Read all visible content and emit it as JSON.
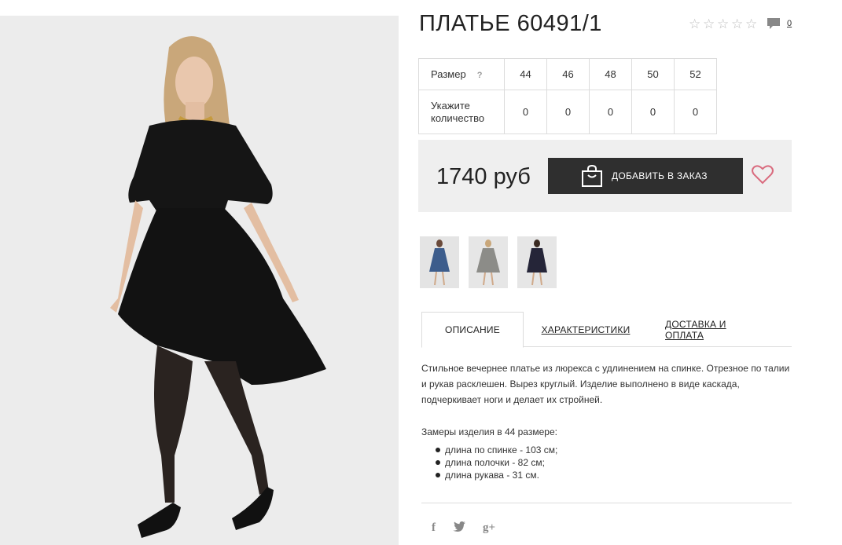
{
  "product": {
    "title": "ПЛАТЬЕ 60491/1",
    "rating_stars": 0,
    "comment_count": "0"
  },
  "sizes": {
    "size_label": "Размер",
    "help_label": "?",
    "qty_label": "Укажите количество",
    "columns": [
      "44",
      "46",
      "48",
      "50",
      "52"
    ],
    "quantities": [
      "0",
      "0",
      "0",
      "0",
      "0"
    ]
  },
  "buy": {
    "price": "1740 руб",
    "add_label": "ДОБАВИТЬ В ЗАКАЗ"
  },
  "tabs": {
    "description": "ОПИСАНИЕ",
    "characteristics": "ХАРАКТЕРИСТИКИ",
    "delivery": "ДОСТАВКА И ОПЛАТА"
  },
  "description": {
    "text": "Стильное вечернее платье из люрекса с удлинением на спинке. Отрезное по талии и рукав расклешен. Вырез круглый. Изделие выполнено в виде каскада, подчеркивает ноги и делает их стройней.",
    "measures_title": "Замеры изделия в 44 размере:",
    "measures": [
      "длина по спинке - 103 см;",
      "длина полочки - 82 см;",
      "длина рукава - 31 см."
    ]
  },
  "social": {
    "facebook": "f",
    "twitter": "t",
    "google": "g+"
  },
  "colors": {
    "button_bg": "#2f2f2f",
    "buy_box_bg": "#efefef",
    "heart": "#d96b7e"
  }
}
